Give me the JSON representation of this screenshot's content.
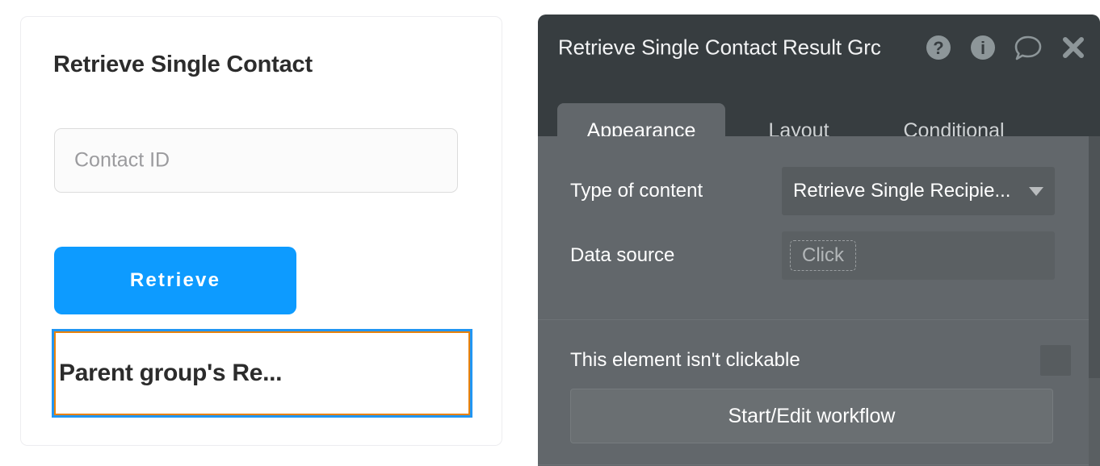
{
  "preview": {
    "title": "Retrieve Single Contact",
    "contact_id_input": {
      "value": "",
      "placeholder": "Contact ID"
    },
    "retrieve_button_label": "Retrieve",
    "parent_group_label": "Parent group's Re...",
    "selection_outer_color": "#2196f3",
    "selection_inner_color": "#e8820c",
    "accent_color": "#0d9bff"
  },
  "panel": {
    "title": "Retrieve Single Contact Result Grc",
    "header_bg": "#373d40",
    "body_bg": "#62676b",
    "icons": [
      {
        "name": "help-icon",
        "glyph": "?"
      },
      {
        "name": "info-icon",
        "glyph": "i"
      },
      {
        "name": "comment-icon",
        "glyph": "speech-bubble"
      },
      {
        "name": "close-icon",
        "glyph": "✕"
      }
    ],
    "tabs": [
      {
        "label": "Appearance",
        "active": true
      },
      {
        "label": "Layout",
        "active": false
      },
      {
        "label": "Conditional",
        "active": false
      }
    ],
    "fields": [
      {
        "label": "Type of content",
        "control": "dropdown",
        "value": "Retrieve Single Recipie..."
      },
      {
        "label": "Data source",
        "control": "composer",
        "value": "",
        "placeholder": "Click"
      }
    ],
    "clickable": {
      "label": "This element isn't clickable",
      "checked": false
    },
    "workflow_button_label": "Start/Edit workflow"
  }
}
